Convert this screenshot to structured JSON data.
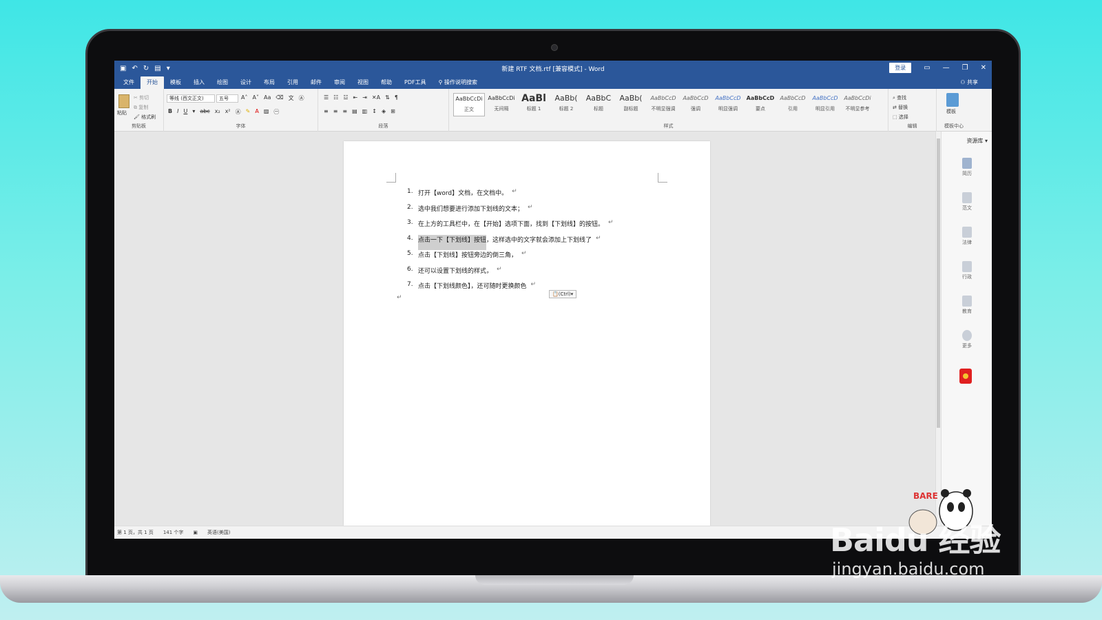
{
  "window": {
    "title": "新建 RTF 文档.rtf [兼容模式] - Word",
    "login_label": "登录",
    "share_label": "共享"
  },
  "tabs": [
    "文件",
    "开始",
    "模板",
    "插入",
    "绘图",
    "设计",
    "布局",
    "引用",
    "邮件",
    "审阅",
    "视图",
    "帮助",
    "PDF工具",
    "操作说明搜索"
  ],
  "ribbon": {
    "clipboard": {
      "label": "剪贴板",
      "paste": "粘贴",
      "cut": "剪切",
      "copy": "复制",
      "format_painter": "格式刷"
    },
    "font": {
      "label": "字体",
      "font_name": "等线 (西文正文)",
      "font_size": "五号"
    },
    "paragraph": {
      "label": "段落"
    },
    "styles": {
      "label": "样式",
      "items": [
        {
          "preview": "AaBbCcDi",
          "name": "正文"
        },
        {
          "preview": "AaBbCcDi",
          "name": "无间隔"
        },
        {
          "preview": "AaBl",
          "name": "标题 1"
        },
        {
          "preview": "AaBb(",
          "name": "标题 2"
        },
        {
          "preview": "AaBbC",
          "name": "标题"
        },
        {
          "preview": "AaBb(",
          "name": "副标题"
        },
        {
          "preview": "AaBbCcD",
          "name": "不明显强调"
        },
        {
          "preview": "AaBbCcD",
          "name": "强调"
        },
        {
          "preview": "AaBbCcD",
          "name": "明显强调"
        },
        {
          "preview": "AaBbCcD",
          "name": "要点"
        },
        {
          "preview": "AaBbCcD",
          "name": "引用"
        },
        {
          "preview": "AaBbCcD",
          "name": "明显引用"
        },
        {
          "preview": "AaBbCcDi",
          "name": "不明显参考"
        }
      ]
    },
    "editing": {
      "label": "编辑",
      "find": "查找",
      "replace": "替换",
      "select": "选择"
    },
    "template": {
      "label": "模板中心",
      "button": "模板"
    }
  },
  "document": {
    "items": [
      {
        "num": "1.",
        "text": "打开【word】文档，在文档中。"
      },
      {
        "num": "2.",
        "text": "选中我们想要进行添加下划线的文本；"
      },
      {
        "num": "3.",
        "text": "在上方的工具栏中，在【开始】选项下面，找到【下划线】的按钮。"
      },
      {
        "num": "4.",
        "highlight": "点击一下【下划线】按钮",
        "text": "，这样选中的文字就会添加上下划线了"
      },
      {
        "num": "5.",
        "text": "点击【下划线】按钮旁边的倒三角，"
      },
      {
        "num": "6.",
        "text": "还可以设置下划线的样式，"
      },
      {
        "num": "7.",
        "text": "点击【下划线颜色】，还可随时更换颜色"
      }
    ],
    "paragraph_mark": "↵",
    "paste_options": "(Ctrl)"
  },
  "side_panel": {
    "title": "资源库",
    "items": [
      "简历",
      "范文",
      "法律",
      "行政",
      "教育",
      "更多"
    ]
  },
  "status": {
    "page": "第 1 页，共 1 页",
    "words": "141 个字",
    "language": "英语(美国)"
  },
  "watermark": {
    "main": "Baidu 经验",
    "sub": "jingyan.baidu.com"
  },
  "colors": {
    "word_blue": "#2b579a",
    "highlight": "#cfcfcf"
  }
}
